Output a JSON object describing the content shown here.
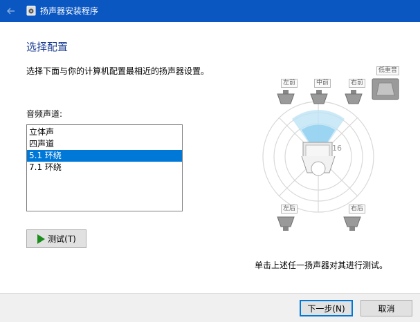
{
  "window": {
    "title": "扬声器安装程序"
  },
  "page": {
    "heading": "选择配置",
    "description": "选择下面与你的计算机配置最相近的扬声器设置。",
    "channels_label": "音频声道:"
  },
  "channels": [
    {
      "label": "立体声"
    },
    {
      "label": "四声道"
    },
    {
      "label": "5.1 环绕",
      "selected": true
    },
    {
      "label": "7.1 环绕"
    }
  ],
  "test_button": {
    "label": "测试(T)"
  },
  "speakers": {
    "front_left": "左前",
    "center": "中前",
    "front_right": "右前",
    "subwoofer": "低重音",
    "rear_left": "左后",
    "rear_right": "右后"
  },
  "hint": "单击上述任一扬声器对其进行测试。",
  "footer": {
    "next_label": "下一步(N)",
    "cancel_label": "取消"
  },
  "colors": {
    "titlebar": "#0b57c2",
    "accent": "#0078d7",
    "heading": "#1e3f94"
  }
}
